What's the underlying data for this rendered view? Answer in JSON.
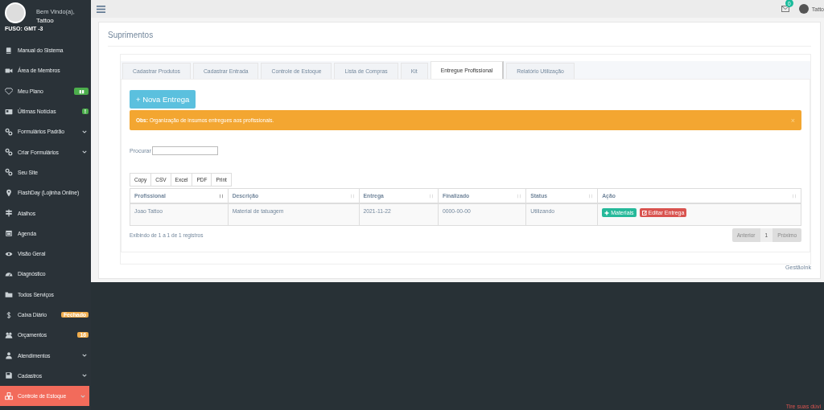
{
  "sidebar": {
    "user": {
      "greeting": "Bem Vindo(a),",
      "name": "Tattoo",
      "timezone": "FUSO: GMT -3"
    },
    "items": [
      {
        "label": "Manual do Sistema",
        "expandable": false,
        "selected": false
      },
      {
        "label": "Área de Membros",
        "expandable": false,
        "selected": false
      },
      {
        "label": "Meu Plano",
        "expandable": false,
        "selected": false,
        "badge": {
          "kind": "icon",
          "color": "#4cae4c"
        }
      },
      {
        "label": "Últimas Notícias",
        "expandable": false,
        "selected": false,
        "badge": {
          "kind": "text",
          "text": "!",
          "color": "#4cae4c"
        }
      },
      {
        "label": "Formulários Padrão",
        "expandable": true,
        "selected": false
      },
      {
        "label": "Criar Formulários",
        "expandable": true,
        "selected": false
      },
      {
        "label": "Seu Site",
        "expandable": false,
        "selected": false
      },
      {
        "label": "FlashDay (Lojinha Online)",
        "expandable": false,
        "selected": false
      },
      {
        "label": "Atalhos",
        "expandable": false,
        "selected": false
      },
      {
        "label": "Agenda",
        "expandable": false,
        "selected": false
      },
      {
        "label": "Visão Geral",
        "expandable": false,
        "selected": false
      },
      {
        "label": "Diagnóstico",
        "expandable": false,
        "selected": false
      },
      {
        "label": "Todos Serviços",
        "expandable": false,
        "selected": false
      },
      {
        "label": "Caixa Diário",
        "expandable": false,
        "selected": false,
        "badge": {
          "kind": "text",
          "text": "Fechado",
          "color": "#f0ad4e"
        }
      },
      {
        "label": "Orçamentos",
        "expandable": false,
        "selected": false,
        "badge": {
          "kind": "text",
          "text": "16",
          "color": "#f0ad4e"
        }
      },
      {
        "label": "Atendimentos",
        "expandable": true,
        "selected": false
      },
      {
        "label": "Cadastros",
        "expandable": true,
        "selected": false
      },
      {
        "label": "Controle de Estoque",
        "expandable": true,
        "selected": true
      }
    ]
  },
  "topbar": {
    "mail_count": "0",
    "user_name": "Tatto"
  },
  "page": {
    "title": "Suprimentos",
    "tabs": [
      {
        "label": "Cadastrar Produtos",
        "selected": false
      },
      {
        "label": "Cadastrar Entrada",
        "selected": false
      },
      {
        "label": "Controle de Estoque",
        "selected": false
      },
      {
        "label": "Lista de Compras",
        "selected": false
      },
      {
        "label": "Kit",
        "selected": false
      },
      {
        "label": "Entregue Profissional",
        "selected": true
      },
      {
        "label": "Relatório Utilização",
        "selected": false
      }
    ],
    "new_button": "+ Nova Entrega",
    "alert": {
      "label": "Obs:",
      "text": "Organização de insumos entregues aos profissionais.",
      "close": "×"
    },
    "search": {
      "label": "Procurar"
    },
    "export_buttons": [
      "Copy",
      "CSV",
      "Excel",
      "PDF",
      "Print"
    ],
    "table": {
      "columns": [
        {
          "label": "Profissional",
          "sorted": true
        },
        {
          "label": "Descrição",
          "sorted": false
        },
        {
          "label": "Entrega",
          "sorted": false
        },
        {
          "label": "Finalizado",
          "sorted": false
        },
        {
          "label": "Status",
          "sorted": false
        },
        {
          "label": "Ação",
          "sorted": false
        }
      ],
      "rows": [
        {
          "cells": [
            "Joao Tattoo",
            "Material de tatuagem",
            "2021-11-22",
            "0000-00-00",
            "Utilizando"
          ],
          "actions": [
            {
              "kind": "add",
              "label": "Materiais"
            },
            {
              "kind": "edit",
              "label": "Editar Entrega"
            }
          ]
        }
      ]
    },
    "info": "Exibindo de 1 a 1 de 1 registros",
    "pagination": {
      "previous": "Anterior",
      "pages": [
        {
          "label": "1",
          "selected": true
        }
      ],
      "next": "Próximo"
    },
    "footer": "GestãoInk"
  },
  "help_link": "Tire suas dúvi"
}
